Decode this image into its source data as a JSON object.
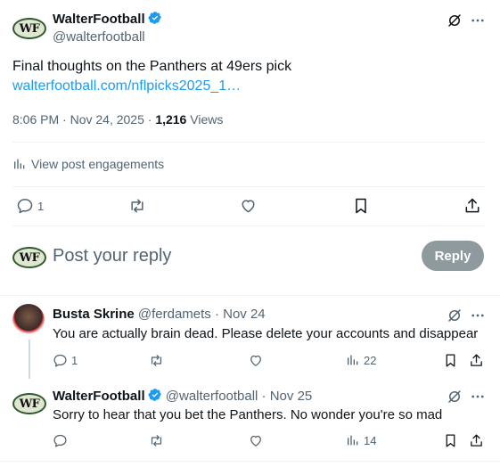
{
  "post": {
    "author_name": "WalterFootball",
    "author_handle": "@walterfootball",
    "avatar_text": "WF",
    "text": "Final thoughts on the Panthers at 49ers pick",
    "link": "walterfootball.com/nflpicks2025_1…",
    "time": "8:06 PM · Nov 24, 2025 · ",
    "views_count": "1,216",
    "views_label": " Views",
    "engagements_label": "View post engagements",
    "reply_count": "1"
  },
  "composer": {
    "placeholder": "Post your reply",
    "reply_button": "Reply",
    "avatar_text": "WF"
  },
  "replies": [
    {
      "author_name": "Busta Skrine",
      "author_handle": "@ferdamets",
      "date": " · Nov 24",
      "text": "You are actually brain dead. Please delete your accounts and disappear",
      "reply_count": "1",
      "views": "22"
    },
    {
      "author_name": "WalterFootball",
      "author_handle": "@walterfootball",
      "date": " · Nov 25",
      "text": "Sorry to hear that you bet the Panthers. No wonder you're so mad",
      "reply_count": "",
      "views": "14",
      "avatar_text": "WF"
    }
  ],
  "colors": {
    "link": "#1d9bf0",
    "verified": "#1d9bf0",
    "muted": "#536471",
    "reply_button_disabled": "#8f9a9f"
  },
  "icons": [
    "verified-badge-icon",
    "grok-icon",
    "more-icon",
    "analytics-icon",
    "reply-icon",
    "repost-icon",
    "like-icon",
    "bookmark-icon",
    "share-icon",
    "views-icon"
  ]
}
